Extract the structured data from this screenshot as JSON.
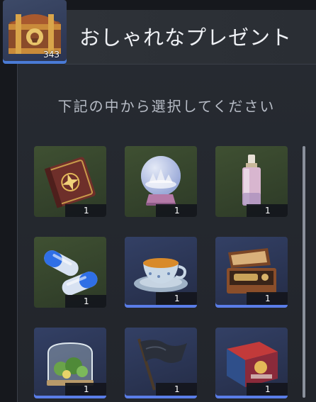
{
  "header": {
    "title": "おしゃれなプレゼント",
    "chest_count": "343"
  },
  "instruction": "下記の中から選択してください",
  "items": [
    {
      "name": "magic-book",
      "qty": "1",
      "rarity": "green"
    },
    {
      "name": "snow-globe",
      "qty": "1",
      "rarity": "green"
    },
    {
      "name": "perfume-bottle",
      "qty": "1",
      "rarity": "green"
    },
    {
      "name": "blue-capsules",
      "qty": "1",
      "rarity": "green"
    },
    {
      "name": "teacup",
      "qty": "1",
      "rarity": "blue"
    },
    {
      "name": "music-box",
      "qty": "1",
      "rarity": "blue"
    },
    {
      "name": "terrarium",
      "qty": "1",
      "rarity": "blue"
    },
    {
      "name": "black-flag",
      "qty": "1",
      "rarity": "blue"
    },
    {
      "name": "board-game-box",
      "qty": "1",
      "rarity": "blue"
    }
  ],
  "colors": {
    "green_frame": "#3f5032",
    "blue_frame": "#334065",
    "blue_accent": "#5a7de8"
  }
}
